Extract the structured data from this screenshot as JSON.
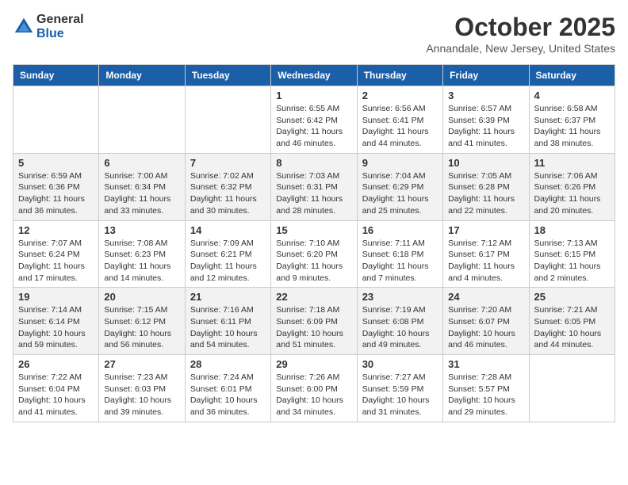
{
  "header": {
    "logo_general": "General",
    "logo_blue": "Blue",
    "month_title": "October 2025",
    "location": "Annandale, New Jersey, United States"
  },
  "days_of_week": [
    "Sunday",
    "Monday",
    "Tuesday",
    "Wednesday",
    "Thursday",
    "Friday",
    "Saturday"
  ],
  "weeks": [
    [
      {
        "day": "",
        "info": ""
      },
      {
        "day": "",
        "info": ""
      },
      {
        "day": "",
        "info": ""
      },
      {
        "day": "1",
        "info": "Sunrise: 6:55 AM\nSunset: 6:42 PM\nDaylight: 11 hours\nand 46 minutes."
      },
      {
        "day": "2",
        "info": "Sunrise: 6:56 AM\nSunset: 6:41 PM\nDaylight: 11 hours\nand 44 minutes."
      },
      {
        "day": "3",
        "info": "Sunrise: 6:57 AM\nSunset: 6:39 PM\nDaylight: 11 hours\nand 41 minutes."
      },
      {
        "day": "4",
        "info": "Sunrise: 6:58 AM\nSunset: 6:37 PM\nDaylight: 11 hours\nand 38 minutes."
      }
    ],
    [
      {
        "day": "5",
        "info": "Sunrise: 6:59 AM\nSunset: 6:36 PM\nDaylight: 11 hours\nand 36 minutes."
      },
      {
        "day": "6",
        "info": "Sunrise: 7:00 AM\nSunset: 6:34 PM\nDaylight: 11 hours\nand 33 minutes."
      },
      {
        "day": "7",
        "info": "Sunrise: 7:02 AM\nSunset: 6:32 PM\nDaylight: 11 hours\nand 30 minutes."
      },
      {
        "day": "8",
        "info": "Sunrise: 7:03 AM\nSunset: 6:31 PM\nDaylight: 11 hours\nand 28 minutes."
      },
      {
        "day": "9",
        "info": "Sunrise: 7:04 AM\nSunset: 6:29 PM\nDaylight: 11 hours\nand 25 minutes."
      },
      {
        "day": "10",
        "info": "Sunrise: 7:05 AM\nSunset: 6:28 PM\nDaylight: 11 hours\nand 22 minutes."
      },
      {
        "day": "11",
        "info": "Sunrise: 7:06 AM\nSunset: 6:26 PM\nDaylight: 11 hours\nand 20 minutes."
      }
    ],
    [
      {
        "day": "12",
        "info": "Sunrise: 7:07 AM\nSunset: 6:24 PM\nDaylight: 11 hours\nand 17 minutes."
      },
      {
        "day": "13",
        "info": "Sunrise: 7:08 AM\nSunset: 6:23 PM\nDaylight: 11 hours\nand 14 minutes."
      },
      {
        "day": "14",
        "info": "Sunrise: 7:09 AM\nSunset: 6:21 PM\nDaylight: 11 hours\nand 12 minutes."
      },
      {
        "day": "15",
        "info": "Sunrise: 7:10 AM\nSunset: 6:20 PM\nDaylight: 11 hours\nand 9 minutes."
      },
      {
        "day": "16",
        "info": "Sunrise: 7:11 AM\nSunset: 6:18 PM\nDaylight: 11 hours\nand 7 minutes."
      },
      {
        "day": "17",
        "info": "Sunrise: 7:12 AM\nSunset: 6:17 PM\nDaylight: 11 hours\nand 4 minutes."
      },
      {
        "day": "18",
        "info": "Sunrise: 7:13 AM\nSunset: 6:15 PM\nDaylight: 11 hours\nand 2 minutes."
      }
    ],
    [
      {
        "day": "19",
        "info": "Sunrise: 7:14 AM\nSunset: 6:14 PM\nDaylight: 10 hours\nand 59 minutes."
      },
      {
        "day": "20",
        "info": "Sunrise: 7:15 AM\nSunset: 6:12 PM\nDaylight: 10 hours\nand 56 minutes."
      },
      {
        "day": "21",
        "info": "Sunrise: 7:16 AM\nSunset: 6:11 PM\nDaylight: 10 hours\nand 54 minutes."
      },
      {
        "day": "22",
        "info": "Sunrise: 7:18 AM\nSunset: 6:09 PM\nDaylight: 10 hours\nand 51 minutes."
      },
      {
        "day": "23",
        "info": "Sunrise: 7:19 AM\nSunset: 6:08 PM\nDaylight: 10 hours\nand 49 minutes."
      },
      {
        "day": "24",
        "info": "Sunrise: 7:20 AM\nSunset: 6:07 PM\nDaylight: 10 hours\nand 46 minutes."
      },
      {
        "day": "25",
        "info": "Sunrise: 7:21 AM\nSunset: 6:05 PM\nDaylight: 10 hours\nand 44 minutes."
      }
    ],
    [
      {
        "day": "26",
        "info": "Sunrise: 7:22 AM\nSunset: 6:04 PM\nDaylight: 10 hours\nand 41 minutes."
      },
      {
        "day": "27",
        "info": "Sunrise: 7:23 AM\nSunset: 6:03 PM\nDaylight: 10 hours\nand 39 minutes."
      },
      {
        "day": "28",
        "info": "Sunrise: 7:24 AM\nSunset: 6:01 PM\nDaylight: 10 hours\nand 36 minutes."
      },
      {
        "day": "29",
        "info": "Sunrise: 7:26 AM\nSunset: 6:00 PM\nDaylight: 10 hours\nand 34 minutes."
      },
      {
        "day": "30",
        "info": "Sunrise: 7:27 AM\nSunset: 5:59 PM\nDaylight: 10 hours\nand 31 minutes."
      },
      {
        "day": "31",
        "info": "Sunrise: 7:28 AM\nSunset: 5:57 PM\nDaylight: 10 hours\nand 29 minutes."
      },
      {
        "day": "",
        "info": ""
      }
    ]
  ]
}
